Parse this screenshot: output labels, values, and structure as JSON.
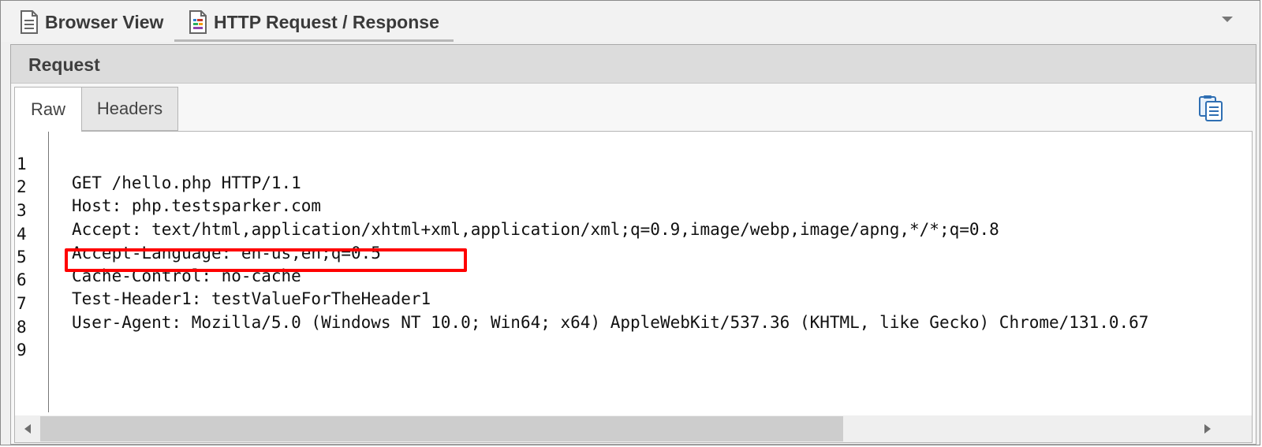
{
  "tabs": {
    "browser_view": "Browser View",
    "http_request_response": "HTTP Request / Response"
  },
  "request_panel": {
    "title": "Request",
    "tabs": {
      "raw": "Raw",
      "headers": "Headers"
    },
    "active_tab": "Raw"
  },
  "editor": {
    "lines": [
      {
        "num": "1",
        "text": "GET /hello.php HTTP/1.1"
      },
      {
        "num": "2",
        "text": "Host: php.testsparker.com"
      },
      {
        "num": "3",
        "text": "Accept: text/html,application/xhtml+xml,application/xml;q=0.9,image/webp,image/apng,*/*;q=0.8"
      },
      {
        "num": "4",
        "text": "Accept-Language: en-us,en;q=0.5"
      },
      {
        "num": "5",
        "text": "Cache-Control: no-cache"
      },
      {
        "num": "6",
        "text": "Test-Header1: testValueForTheHeader1"
      },
      {
        "num": "7",
        "text": "User-Agent: Mozilla/5.0 (Windows NT 10.0; Win64; x64) AppleWebKit/537.36 (KHTML, like Gecko) Chrome/131.0.67"
      },
      {
        "num": "8",
        "text": ""
      },
      {
        "num": "9",
        "text": ""
      }
    ],
    "highlighted_line": 6,
    "highlight_color": "#ff0000"
  },
  "icons": {
    "browser_view": "document-icon",
    "http_request_response": "request-document-icon",
    "copy": "copy-icon",
    "dropdown": "chevron-down-icon"
  }
}
